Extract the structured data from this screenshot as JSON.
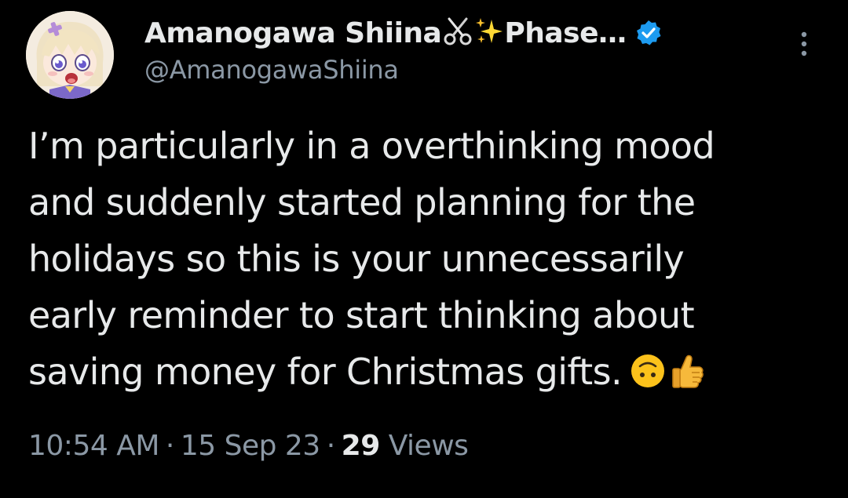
{
  "tweet": {
    "author": {
      "display_name": "Amanogawa Shiina",
      "name_emojis": [
        "scissors-icon",
        "sparkles-icon"
      ],
      "name_suffix": "Phase…",
      "handle": "@AmanogawaShiina",
      "verified": true,
      "avatar": "anime-girl-avatar"
    },
    "text_lines": [
      "I’m particularly in a overthinking mood",
      "and suddenly started planning for the",
      "holidays so this is your unnecessarily",
      "early reminder to start thinking about",
      "saving money for Christmas gifts."
    ],
    "text_emojis": [
      "upside-down-face-icon",
      "thumbs-up-icon"
    ],
    "time": "10:54 AM",
    "date": "15 Sep 23",
    "views_count": "29",
    "views_label": "Views",
    "separator": "·"
  },
  "colors": {
    "background": "#000000",
    "primary_text": "#e7e9ea",
    "secondary_text": "#8b98a5",
    "verified_badge": "#1d9bf0"
  }
}
